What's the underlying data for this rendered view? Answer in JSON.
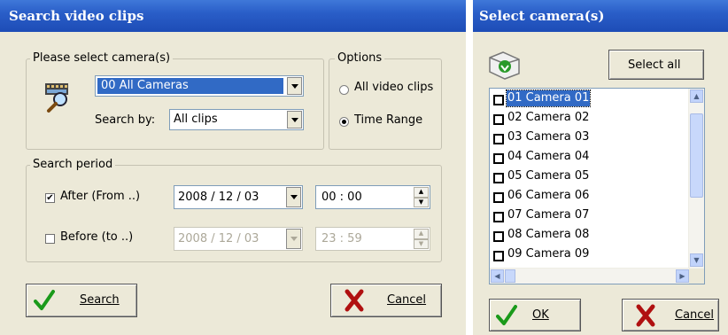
{
  "search_window": {
    "title": "Search video clips",
    "camera_group": {
      "legend": "Please select camera(s)",
      "camera_value": "00 All Cameras",
      "search_by_label": "Search by:",
      "search_by_value": "All clips"
    },
    "options_group": {
      "legend": "Options",
      "all_clips_label": "All video clips",
      "time_range_label": "Time Range",
      "selected": "Time Range"
    },
    "period_group": {
      "legend": "Search period",
      "after_label": "After (From ..)",
      "after_checked": true,
      "after_date": "2008 / 12 / 03",
      "after_time": "00  :  00",
      "before_label": "Before  (to ..)",
      "before_checked": false,
      "before_date": "2008 / 12 / 03",
      "before_time": "23  :  59"
    },
    "search_button": "Search",
    "cancel_button": "Cancel"
  },
  "camera_window": {
    "title": "Select camera(s)",
    "select_all_button": "Select all",
    "cameras": [
      "01 Camera 01",
      "02 Camera 02",
      "03 Camera 03",
      "04 Camera 04",
      "05 Camera 05",
      "06 Camera 06",
      "07 Camera 07",
      "08 Camera 08",
      "09 Camera 09"
    ],
    "selected_camera": "01 Camera 01",
    "ok_button": "OK",
    "cancel_button": "Cancel"
  },
  "colors": {
    "title_bar": "#2a5ec8",
    "dialog_bg": "#ece9d8",
    "selection": "#316ac5"
  }
}
